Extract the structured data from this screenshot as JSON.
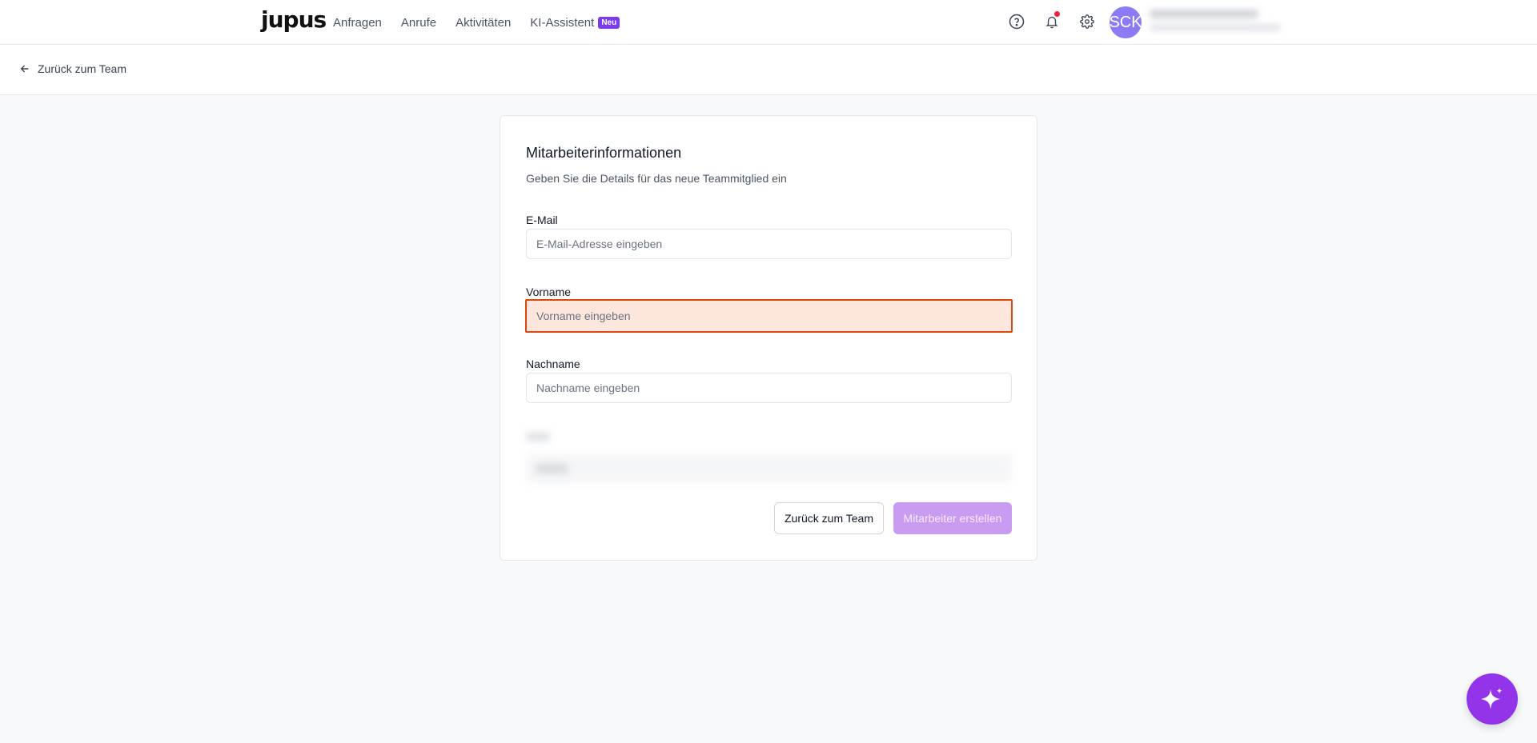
{
  "header": {
    "logo": "jupus",
    "nav": [
      {
        "label": "Anfragen"
      },
      {
        "label": "Anrufe"
      },
      {
        "label": "Aktivitäten"
      },
      {
        "label": "KI-Assistent",
        "badge": "Neu"
      }
    ],
    "avatar_initials": "SCK"
  },
  "subheader": {
    "back_label": "Zurück zum Team"
  },
  "form": {
    "title": "Mitarbeiterinformationen",
    "subtitle": "Geben Sie die Details für das neue Teammitglied ein",
    "email": {
      "label": "E-Mail",
      "placeholder": "E-Mail-Adresse eingeben",
      "value": ""
    },
    "firstname": {
      "label": "Vorname",
      "placeholder": "Vorname eingeben",
      "value": ""
    },
    "lastname": {
      "label": "Nachname",
      "placeholder": "Nachname eingeben",
      "value": ""
    },
    "cancel_label": "Zurück zum Team",
    "submit_label": "Mitarbeiter erstellen"
  },
  "colors": {
    "accent": "#9333ea",
    "badge": "#7c3aed",
    "error_border": "#d9480f",
    "error_bg": "#fde6dc",
    "submit_disabled": "#c99cf2"
  },
  "icons": [
    "arrow-left-icon",
    "help-circle-icon",
    "bell-icon",
    "gear-icon",
    "sparkle-icon"
  ]
}
